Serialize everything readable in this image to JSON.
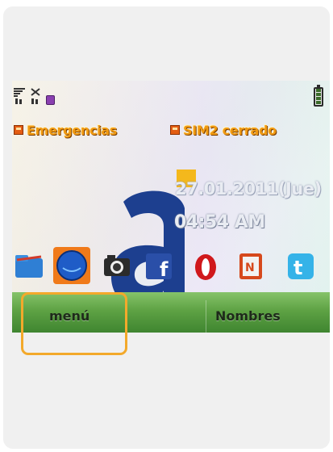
{
  "status": {
    "notifications": [
      {
        "label": "Emergencias"
      },
      {
        "label": "SIM2 cerrado"
      }
    ]
  },
  "clock": {
    "date": "27.01.2011(Jue)",
    "time": "04:54 AM"
  },
  "dock": {
    "apps": [
      {
        "icon": "folder-icon"
      },
      {
        "icon": "browser-globe-icon"
      },
      {
        "icon": "camera-icon"
      },
      {
        "icon": "facebook-icon"
      },
      {
        "icon": "opera-icon"
      },
      {
        "icon": "news-icon"
      },
      {
        "icon": "twitter-icon"
      }
    ]
  },
  "softkeys": {
    "left": "menú",
    "right": "Nombres"
  },
  "colors": {
    "accent_orange": "#f19a12",
    "softkey_green": "#5ea244",
    "highlight": "#f3a92b",
    "brand_blue": "#1d3f8f",
    "brand_yellow": "#f4b81c"
  }
}
